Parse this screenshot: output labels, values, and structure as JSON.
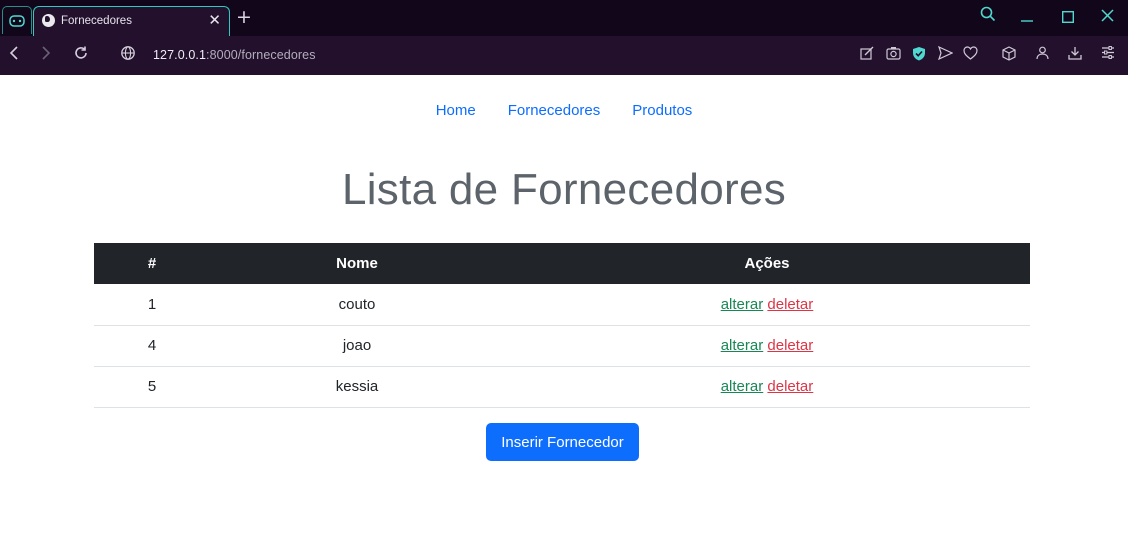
{
  "browser": {
    "tab_title": "Fornecedores",
    "url_host": "127.0.0.1",
    "url_path": ":8000/fornecedores"
  },
  "nav": {
    "links": [
      "Home",
      "Fornecedores",
      "Produtos"
    ]
  },
  "page_title": "Lista de Fornecedores",
  "table": {
    "headers": [
      "#",
      "Nome",
      "Ações"
    ],
    "rows": [
      {
        "id": "1",
        "nome": "couto",
        "edit": "alterar",
        "delete": "deletar"
      },
      {
        "id": "4",
        "nome": "joao",
        "edit": "alterar",
        "delete": "deletar"
      },
      {
        "id": "5",
        "nome": "kessia",
        "edit": "alterar",
        "delete": "deletar"
      }
    ]
  },
  "insert_button": "Inserir Fornecedor",
  "colors": {
    "link": "#0d6efd",
    "edit": "#198754",
    "delete": "#dc3545",
    "table_header": "#212529",
    "button": "#0d6efd"
  }
}
